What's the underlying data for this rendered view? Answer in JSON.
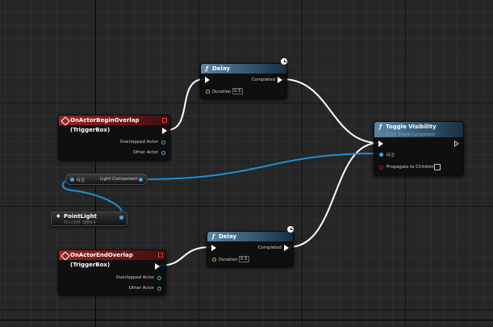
{
  "delay_top": {
    "title": "Delay",
    "output_label": "Completed",
    "duration_label": "Duration",
    "duration_value": "0.5"
  },
  "delay_bottom": {
    "title": "Delay",
    "output_label": "Completed",
    "duration_label": "Duration",
    "duration_value": "0.5"
  },
  "begin_overlap": {
    "title": "OnActorBeginOverlap (TriggerBox)",
    "overlapped_label": "Overlapped Actor",
    "other_label": "Other Actor"
  },
  "end_overlap": {
    "title": "OnActorEndOverlap (TriggerBox)",
    "overlapped_label": "Overlapped Actor",
    "other_label": "Other Actor"
  },
  "toggle": {
    "title": "Toggle Visibility",
    "subtitle": "타깃은 Scene Component",
    "target_label": "타깃",
    "propagate_label": "Propagate to Children"
  },
  "light_component": {
    "target_label": "타깃",
    "output_label": "Light Component"
  },
  "point_light": {
    "title": "PointLight",
    "subtitle": "퍼시스턴트 레벨에서"
  },
  "colors": {
    "exec_wire": "#ffffff",
    "object_wire": "#1f8fd6",
    "function_header": "#5a86a6",
    "event_header": "#9c2323",
    "float_pin": "#86d13a"
  }
}
